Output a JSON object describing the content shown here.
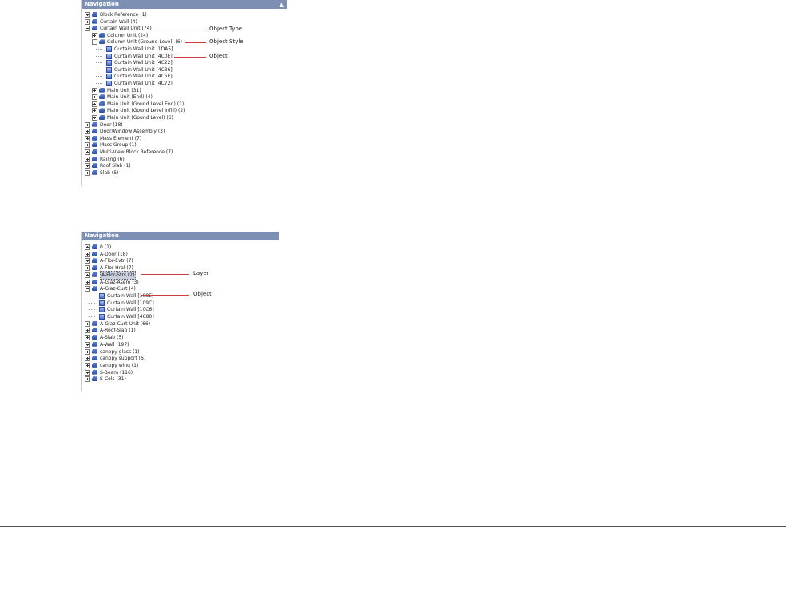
{
  "panel1": {
    "header": "Navigation",
    "collapse_glyph": "▲",
    "rows": [
      {
        "label": "Block Reference (1)"
      },
      {
        "label": "Curtain Wall (4)"
      },
      {
        "label": "Curtain Wall Unit (74)"
      },
      {
        "label": "Column Unit (24)"
      },
      {
        "label": "Column Unit (Ground Level) (6)"
      },
      {
        "label": "Curtain Wall Unit [1DA5]"
      },
      {
        "label": "Curtain Wall Unit [4C0E]"
      },
      {
        "label": "Curtain Wall Unit [4C22]"
      },
      {
        "label": "Curtain Wall Unit [4C36]"
      },
      {
        "label": "Curtain Wall Unit [4C5E]"
      },
      {
        "label": "Curtain Wall Unit [4C72]"
      },
      {
        "label": "Main Unit (31)"
      },
      {
        "label": "Main Unit (End) (4)"
      },
      {
        "label": "Main Unit (Gound Level End) (1)"
      },
      {
        "label": "Main Unit (Gound Level Infill) (2)"
      },
      {
        "label": "Main Unit (Gound Level) (6)"
      },
      {
        "label": "Door (18)"
      },
      {
        "label": "Door/Window Assembly (3)"
      },
      {
        "label": "Mass Element (7)"
      },
      {
        "label": "Mass Group (1)"
      },
      {
        "label": "Multi-View Block Reference (7)"
      },
      {
        "label": "Railing (6)"
      },
      {
        "label": "Roof Slab (1)"
      },
      {
        "label": "Slab (5)"
      }
    ],
    "callouts": {
      "object_type": "Object Type",
      "object_style": "Object Style",
      "object": "Object"
    }
  },
  "panel2": {
    "header": "Navigation",
    "rows": [
      {
        "label": "0 (1)"
      },
      {
        "label": "A-Door (18)"
      },
      {
        "label": "A-Flor-Evtr (7)"
      },
      {
        "label": "A-Flor-Hral (7)"
      },
      {
        "label": "A-Flor-Strs (2)"
      },
      {
        "label": "A-Glaz-Asem (3)"
      },
      {
        "label": "A-Glaz-Curt (4)"
      },
      {
        "label": "Curtain Wall [108E]"
      },
      {
        "label": "Curtain Wall [109C]"
      },
      {
        "label": "Curtain Wall [10C6]"
      },
      {
        "label": "Curtain Wall [4C80]"
      },
      {
        "label": "A-Glaz-Curt-Unit (66)"
      },
      {
        "label": "A-Roof-Slab (1)"
      },
      {
        "label": "A-Slab (5)"
      },
      {
        "label": "A-Wall (197)"
      },
      {
        "label": "canopy glass (1)"
      },
      {
        "label": "canopy support (6)"
      },
      {
        "label": "canopy wing (1)"
      },
      {
        "label": "S-Beam (116)"
      },
      {
        "label": "S-Cols (31)"
      }
    ],
    "callouts": {
      "layer": "Layer",
      "object": "Object"
    }
  },
  "colors": {
    "header_bg": "#7d8fb3",
    "callout_line": "#d23b3b",
    "tree_icon": "#2b4fa8"
  }
}
